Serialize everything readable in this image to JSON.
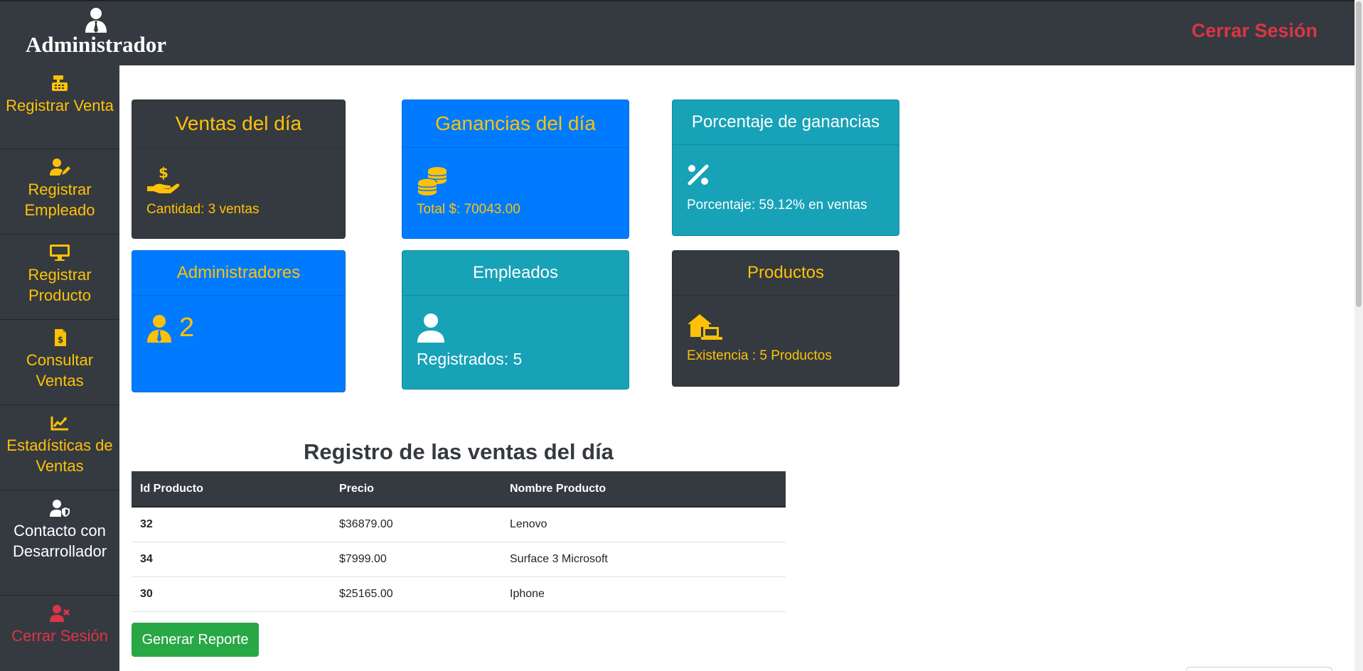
{
  "header": {
    "title": "Administrador",
    "logout_label": "Cerrar Sesión"
  },
  "sidebar": {
    "items": [
      {
        "label": "Registrar Venta",
        "icon": "cash-register-icon"
      },
      {
        "label": "Registrar Empleado",
        "icon": "user-edit-icon"
      },
      {
        "label": "Registrar Producto",
        "icon": "desktop-icon"
      },
      {
        "label": "Consultar Ventas",
        "icon": "file-invoice-dollar-icon"
      },
      {
        "label": "Estadísticas de Ventas",
        "icon": "chart-line-icon"
      },
      {
        "label": "Contacto con Desarrollador",
        "icon": "user-shield-icon"
      },
      {
        "label": "Cerrar Sesión",
        "icon": "user-times-icon"
      }
    ]
  },
  "cards": {
    "ventas": {
      "title": "Ventas del día",
      "text": "Cantidad: 3 ventas",
      "icon": "hand-holding-usd-icon"
    },
    "ganancias": {
      "title": "Ganancias del día",
      "text": "Total $: 70043.00",
      "icon": "coins-icon"
    },
    "porcentaje": {
      "title": "Porcentaje de ganancias",
      "text": "Porcentaje: 59.12% en ventas",
      "icon": "percent-icon"
    },
    "administradores": {
      "title": "Administradores",
      "value": "2",
      "icon": "user-tie-icon"
    },
    "empleados": {
      "title": "Empleados",
      "text": "Registrados: 5",
      "icon": "user-icon"
    },
    "productos": {
      "title": "Productos",
      "text": "Existencia : 5 Productos",
      "icon": "house-laptop-icon"
    }
  },
  "sales_table": {
    "title": "Registro de las ventas del día",
    "columns": [
      "Id Producto",
      "Precio",
      "Nombre Producto"
    ],
    "rows": [
      [
        "32",
        "$36879.00",
        "Lenovo"
      ],
      [
        "34",
        "$7999.00",
        "Surface 3 Microsoft"
      ],
      [
        "30",
        "$25165.00",
        "Iphone"
      ]
    ]
  },
  "report_button": "Generar Reporte",
  "colors": {
    "dark": "#343a40",
    "primary": "#007bff",
    "info": "#17a2b8",
    "warning": "#ffc107",
    "danger": "#dc3545",
    "success": "#28a745"
  }
}
